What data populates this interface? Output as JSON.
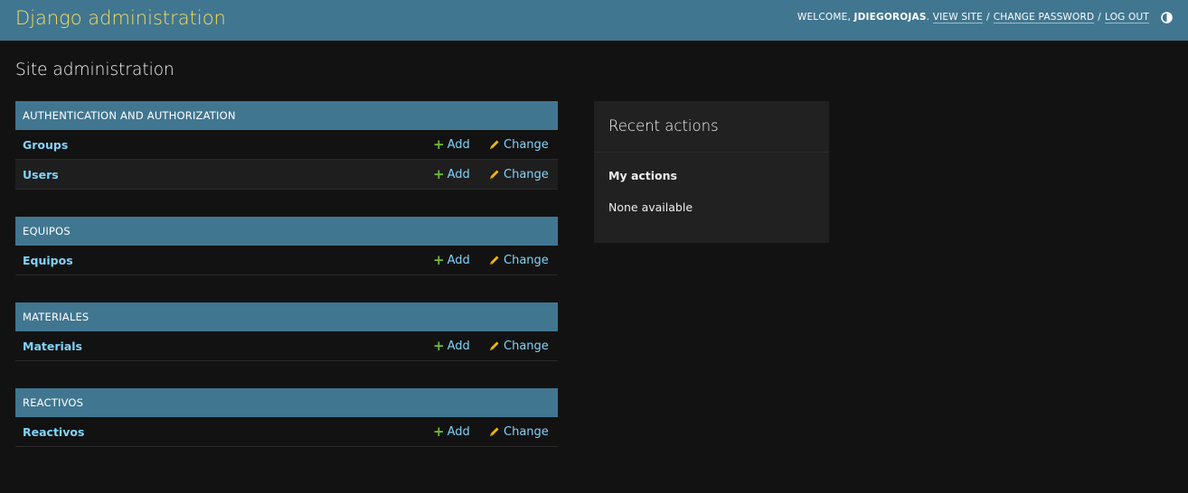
{
  "header": {
    "branding": "Django administration",
    "welcome": "WELCOME,",
    "username": "JDIEGOROJAS",
    "username_suffix": ".",
    "view_site": "VIEW SITE",
    "change_password": "CHANGE PASSWORD",
    "log_out": "LOG OUT",
    "separator": "/",
    "theme_icon": "half-circle-icon"
  },
  "page_title": "Site administration",
  "modules": [
    {
      "caption": "AUTHENTICATION AND AUTHORIZATION",
      "rows": [
        {
          "name": "Groups",
          "add": "Add",
          "change": "Change"
        },
        {
          "name": "Users",
          "add": "Add",
          "change": "Change"
        }
      ]
    },
    {
      "caption": "EQUIPOS",
      "rows": [
        {
          "name": "Equipos",
          "add": "Add",
          "change": "Change"
        }
      ]
    },
    {
      "caption": "MATERIALES",
      "rows": [
        {
          "name": "Materials",
          "add": "Add",
          "change": "Change"
        }
      ]
    },
    {
      "caption": "REACTIVOS",
      "rows": [
        {
          "name": "Reactivos",
          "add": "Add",
          "change": "Change"
        }
      ]
    }
  ],
  "recent_actions": {
    "title": "Recent actions",
    "subtitle": "My actions",
    "empty": "None available"
  },
  "colors": {
    "header_bg": "#417690",
    "branding": "#f5dd5d",
    "link": "#81d4fa",
    "add_icon": "#70bf2b",
    "change_icon": "#efb80b",
    "background": "#121212"
  }
}
